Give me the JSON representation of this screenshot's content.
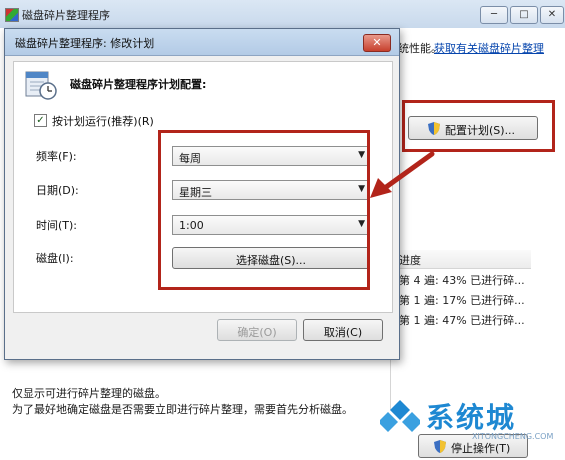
{
  "main_window": {
    "title": "磁盘碎片整理程序",
    "minimize_glyph": "─",
    "maximize_glyph": "□",
    "close_glyph": "✕",
    "top_text": "统性能。",
    "top_link": "获取有关磁盘碎片整理",
    "configure_button": "配置计划(S)...",
    "progress_header": "进度",
    "progress_rows": [
      "第 4 遍: 43% 已进行碎...",
      "第 1 遍: 17% 已进行碎...",
      "第 1 遍: 47% 已进行碎..."
    ],
    "footer_lines": [
      "仅显示可进行碎片整理的磁盘。",
      "为了最好地确定磁盘是否需要立即进行碎片整理，需要首先分析磁盘。"
    ],
    "stop_button": "停止操作(T)"
  },
  "dialog": {
    "title": "磁盘碎片整理程序: 修改计划",
    "close_glyph": "✕",
    "heading": "磁盘碎片整理程序计划配置:",
    "checkbox_label": "按计划运行(推荐)(R)",
    "checkbox_checked": true,
    "frequency_label": "频率(F):",
    "frequency_value": "每周",
    "day_label": "日期(D):",
    "day_value": "星期三",
    "time_label": "时间(T):",
    "time_value": "1:00",
    "disk_label": "磁盘(I):",
    "select_disk_button": "选择磁盘(S)...",
    "ok_button": "确定(O)",
    "cancel_button": "取消(C)"
  },
  "watermark": {
    "text": "系统城",
    "url": "XITONGCHENG.COM"
  },
  "colors": {
    "annotation_red": "#b2241a",
    "link_blue": "#0645ad",
    "watermark_blue": "#1e88d2"
  }
}
